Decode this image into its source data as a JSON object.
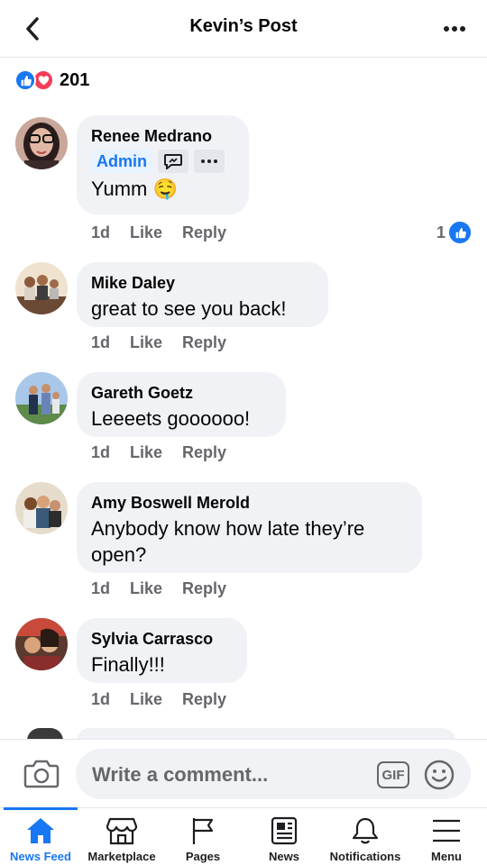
{
  "header": {
    "title": "Kevin’s Post"
  },
  "reactions": {
    "count": "201"
  },
  "comments": [
    {
      "name": "Renee Medrano",
      "badge": "Admin",
      "text": "Yumm 🤤",
      "time": "1d",
      "like": "Like",
      "reply": "Reply",
      "likes": "1"
    },
    {
      "name": "Mike Daley",
      "text": "great to see you back!",
      "time": "1d",
      "like": "Like",
      "reply": "Reply"
    },
    {
      "name": "Gareth Goetz",
      "text": "Leeeets goooooo!",
      "time": "1d",
      "like": "Like",
      "reply": "Reply"
    },
    {
      "name": "Amy Boswell Merold",
      "text": "Anybody know how late they’re open?",
      "time": "1d",
      "like": "Like",
      "reply": "Reply"
    },
    {
      "name": "Sylvia Carrasco",
      "text": "Finally!!!",
      "time": "1d",
      "like": "Like",
      "reply": "Reply"
    }
  ],
  "composer": {
    "placeholder": "Write a comment...",
    "gif": "GIF"
  },
  "tabs": [
    {
      "label": "News Feed",
      "icon": "home-icon",
      "active": true
    },
    {
      "label": "Marketplace",
      "icon": "marketplace-icon"
    },
    {
      "label": "Pages",
      "icon": "flag-icon"
    },
    {
      "label": "News",
      "icon": "newspaper-icon"
    },
    {
      "label": "Notifications",
      "icon": "bell-icon"
    },
    {
      "label": "Menu",
      "icon": "hamburger-icon"
    }
  ],
  "colors": {
    "accent": "#1877f2",
    "love": "#f33e58",
    "bubble": "#f0f2f5",
    "meta": "#65676b"
  }
}
